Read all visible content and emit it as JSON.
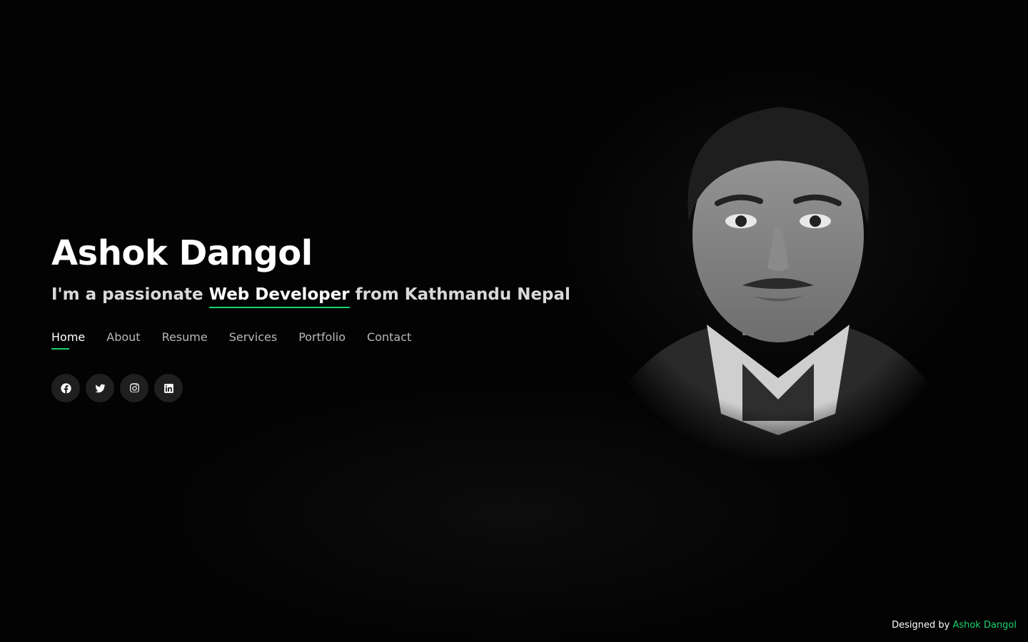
{
  "header": {
    "name": "Ashok Dangol",
    "tagline_prefix": "I'm a passionate",
    "tagline_role": "Web Developer",
    "tagline_suffix": "from Kathmandu Nepal"
  },
  "nav": {
    "items": [
      {
        "label": "Home",
        "active": true
      },
      {
        "label": "About"
      },
      {
        "label": "Resume"
      },
      {
        "label": "Services"
      },
      {
        "label": "Portfolio"
      },
      {
        "label": "Contact"
      }
    ]
  },
  "social": {
    "icons": [
      "facebook-icon",
      "twitter-icon",
      "instagram-icon",
      "linkedin-icon"
    ]
  },
  "credits": {
    "prefix": "Designed by",
    "author": "Ashok Dangol"
  },
  "colors": {
    "accent": "#18d26e",
    "background": "#030303",
    "text": "#ffffff"
  }
}
